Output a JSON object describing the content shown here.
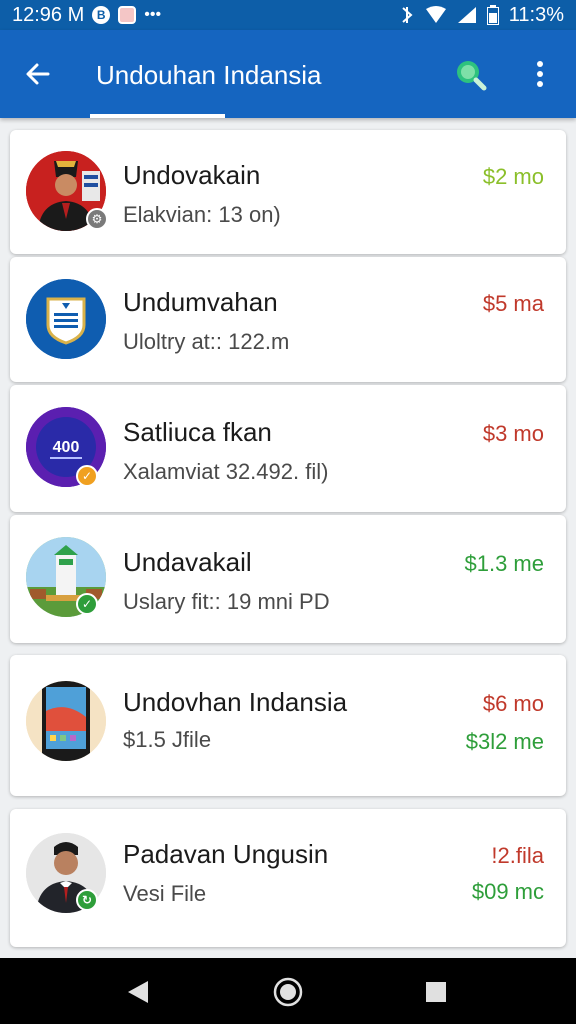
{
  "status_bar": {
    "time": "12:96 M",
    "battery": "11:3%"
  },
  "app_bar": {
    "title": "Undouhan Indansia"
  },
  "colors": {
    "app_bar": "#1565c0",
    "status_bar": "#0d5ea8",
    "price_green": "#2e9e3a",
    "price_lime": "#8bbf2a",
    "price_red": "#c0392b"
  },
  "items": [
    {
      "title": "Undovakain",
      "subtitle": "Elakvian: 13 on)",
      "price": "$2 mo",
      "price_color": "#8bbf2a"
    },
    {
      "title": "Undumvahan",
      "subtitle": "Uloltry at:: 122.m",
      "price": "$5 ma",
      "price_color": "#c0392b"
    },
    {
      "title": "Satliuca fkan",
      "subtitle": "Xalamviat 32.492. fil)",
      "price": "$3 mo",
      "price_color": "#c0392b"
    },
    {
      "title": "Undavakail",
      "subtitle": "Uslary fit:: 19 mni PD",
      "price": "$1.3 me",
      "price_color": "#2e9e3a"
    },
    {
      "title": "Undovhan Indansia",
      "subtitle": "$1.5 Jfile",
      "price": "$6 mo",
      "price_color": "#c0392b",
      "price2": "$3l2 me",
      "price2_color": "#2e9e3a"
    },
    {
      "title": "Padavan Ungusin",
      "subtitle": "Vesi File",
      "price": "!2.fila",
      "price_color": "#c0392b",
      "price2": "$09 mc",
      "price2_color": "#2e9e3a"
    }
  ],
  "avatar_texts": {
    "item3": "400"
  },
  "nav": {
    "back": "back-icon",
    "home": "home-icon",
    "recents": "recents-icon"
  }
}
